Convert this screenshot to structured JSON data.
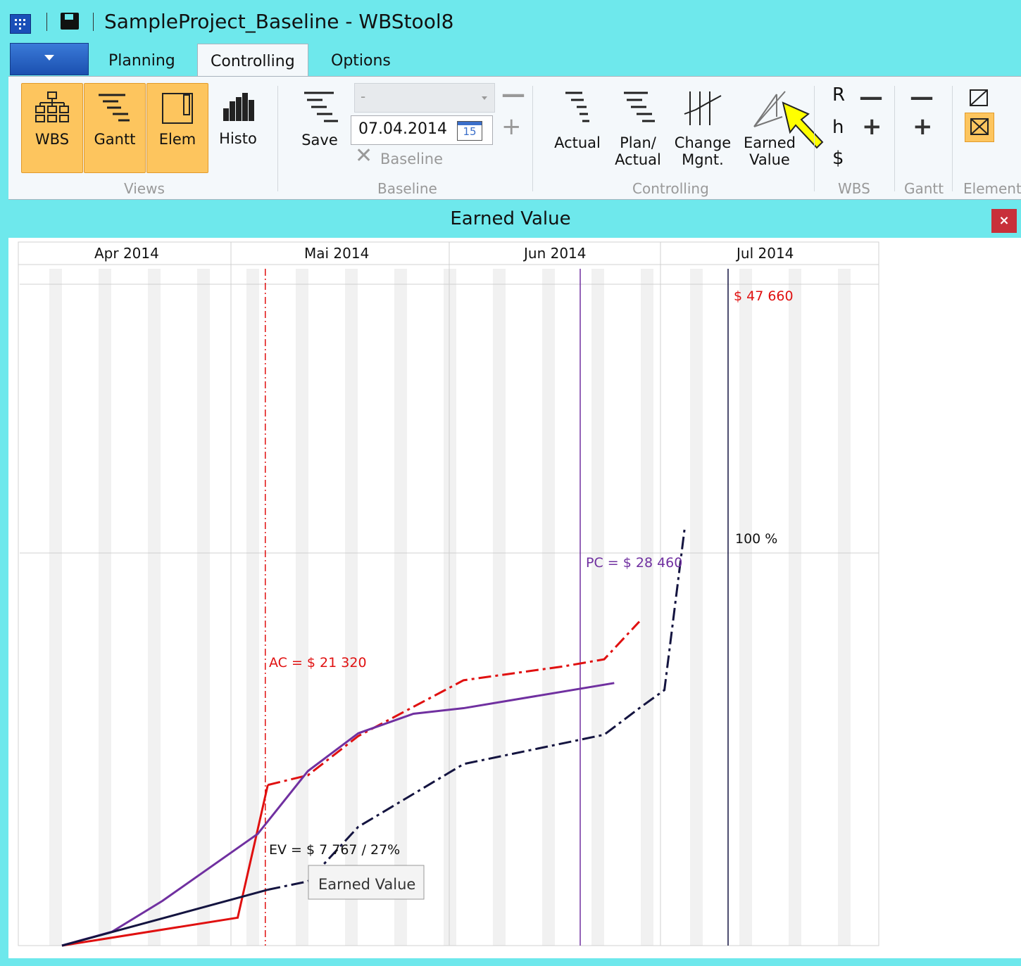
{
  "window": {
    "title": "SampleProject_Baseline - WBStool8"
  },
  "tabs": [
    {
      "label": "Planning",
      "active": false
    },
    {
      "label": "Controlling",
      "active": true
    },
    {
      "label": "Options",
      "active": false
    }
  ],
  "ribbon": {
    "views": {
      "label": "Views",
      "buttons": [
        {
          "label": "WBS",
          "icon": "wbs-tree-icon",
          "selected": true
        },
        {
          "label": "Gantt",
          "icon": "gantt-icon",
          "selected": true
        },
        {
          "label": "Elem",
          "icon": "element-icon",
          "selected": true
        },
        {
          "label": "Histo",
          "icon": "histogram-icon",
          "selected": false
        }
      ]
    },
    "baseline": {
      "label": "Baseline",
      "save_label": "Save",
      "combo_value": "-",
      "date_value": "07.04.2014",
      "calendar_day": "15",
      "delete_label": "Baseline"
    },
    "controlling": {
      "label": "Controlling",
      "buttons": [
        {
          "label": "Actual",
          "icon": "actual-icon"
        },
        {
          "label": "Plan/\nActual",
          "icon": "plan-actual-icon"
        },
        {
          "label": "Change\nMgnt.",
          "icon": "change-management-icon"
        },
        {
          "label": "Earned\nValue",
          "icon": "earned-value-icon"
        }
      ]
    },
    "wbs": {
      "label": "WBS",
      "letters": [
        "R",
        "h",
        "$"
      ]
    },
    "gantt": {
      "label": "Gantt"
    },
    "element": {
      "label": "Element"
    }
  },
  "panel": {
    "title": "Earned Value",
    "close_label": "×",
    "tooltip": "Earned Value"
  },
  "accent": {
    "titlebar": "#6ee8ec",
    "selected": "#fdc55e",
    "ac": "#e01010",
    "pc": "#7030a0",
    "ev": "#141440"
  },
  "chart_data": {
    "type": "line",
    "months": [
      "Apr 2014",
      "Mai 2014",
      "Jun 2014",
      "Jul 2014"
    ],
    "x_unit": "day offset from project start (weeks shaded)",
    "status_date_label": "AC = $ 21 320",
    "labels": {
      "ac": "AC = $ 21 320",
      "ev": "EV = $ 7 767 / 27%",
      "pc": "PC = $ 28 460",
      "total": "$ 47 660",
      "hundred": "100 %"
    },
    "series": [
      {
        "name": "AC",
        "style": "solid-then-dashdot",
        "values": [
          [
            0,
            0
          ],
          [
            35,
            2
          ],
          [
            41,
            11.5
          ],
          [
            49,
            12.2
          ],
          [
            59,
            15
          ],
          [
            80,
            19
          ],
          [
            100,
            20
          ],
          [
            108,
            20.5
          ],
          [
            115,
            23.2
          ]
        ]
      },
      {
        "name": "PC",
        "style": "solid",
        "values": [
          [
            0,
            0
          ],
          [
            10,
            1
          ],
          [
            20,
            3.2
          ],
          [
            39,
            8
          ],
          [
            49,
            12.5
          ],
          [
            59,
            15.2
          ],
          [
            70,
            16.6
          ],
          [
            80,
            17
          ],
          [
            90,
            17.6
          ],
          [
            110,
            18.8
          ]
        ]
      },
      {
        "name": "EV",
        "style": "solid-then-dashdot",
        "values": [
          [
            0,
            0
          ],
          [
            41,
            4
          ],
          [
            49,
            4.6
          ],
          [
            59,
            8.5
          ],
          [
            80,
            13
          ],
          [
            100,
            14.5
          ],
          [
            108,
            15.1
          ],
          [
            115,
            17
          ],
          [
            120,
            18.3
          ],
          [
            124,
            29.8
          ]
        ]
      }
    ]
  }
}
